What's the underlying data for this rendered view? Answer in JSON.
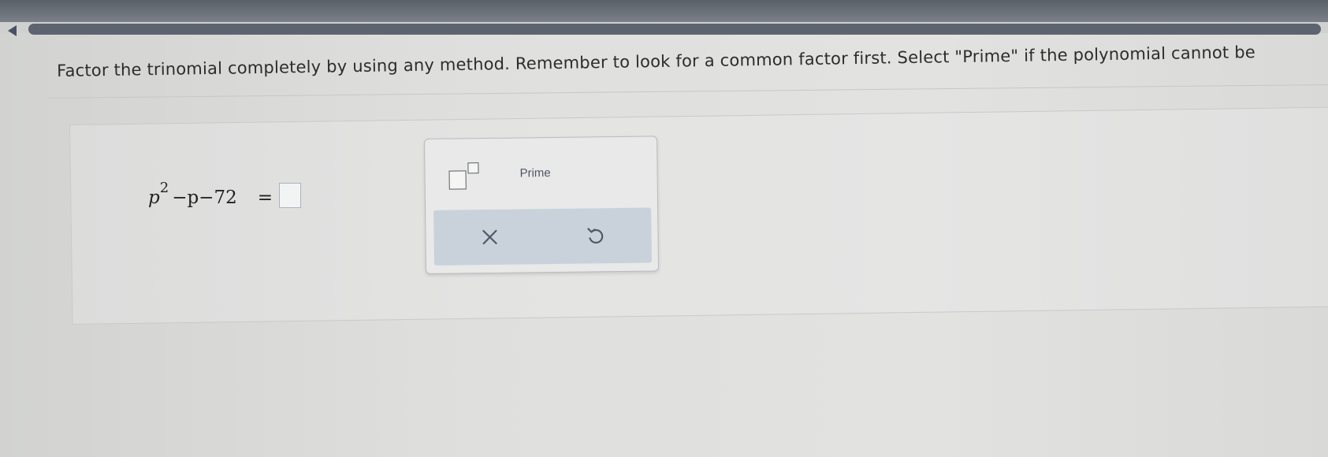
{
  "progress": {
    "fraction": 1.0
  },
  "question": {
    "text": "Factor the trinomial completely by using any method. Remember to look for a common factor first. Select \"Prime\" if the polynomial cannot be"
  },
  "equation": {
    "variable": "p",
    "exponent": "2",
    "rest": "−p−72",
    "equals": "="
  },
  "keypad": {
    "prime_label": "Prime",
    "clear_label": "×",
    "undo_label": "↺"
  },
  "colors": {
    "progress_fill": "#5d6470",
    "action_bar": "#c9d2db",
    "icon": "#4f5a68"
  },
  "icons": {
    "back": "back-arrow-icon",
    "exponent": "exponent-template-icon",
    "clear": "close-icon",
    "undo": "undo-icon"
  }
}
